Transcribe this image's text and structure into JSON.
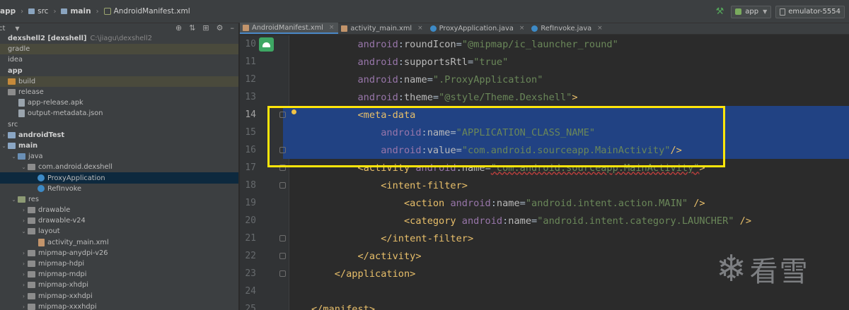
{
  "breadcrumb": [
    "app",
    "src",
    "main",
    "AndroidManifest.xml"
  ],
  "toolbar": {
    "run_config": "app",
    "device": "emulator-5554"
  },
  "project": {
    "header": "ct",
    "rows": [
      {
        "label": "dexshell2 [dexshell]",
        "path": "C:\\jiagu\\dexshell2",
        "bold": true,
        "indent": 0,
        "arrow": "",
        "icon": "none"
      },
      {
        "label": "gradle",
        "indent": 0,
        "arrow": "",
        "icon": "none",
        "excluded": true
      },
      {
        "label": "idea",
        "indent": 0,
        "arrow": "",
        "icon": "none"
      },
      {
        "label": "app",
        "indent": 0,
        "arrow": "",
        "icon": "none",
        "bold": true
      },
      {
        "label": "build",
        "indent": 0,
        "arrow": "",
        "icon": "folder-orange",
        "excluded": true
      },
      {
        "label": "release",
        "indent": 0,
        "arrow": "",
        "icon": "folder"
      },
      {
        "label": "app-release.apk",
        "indent": 1,
        "arrow": "",
        "icon": "file"
      },
      {
        "label": "output-metadata.json",
        "indent": 1,
        "arrow": "",
        "icon": "file"
      },
      {
        "label": "src",
        "indent": 0,
        "arrow": "",
        "icon": "none"
      },
      {
        "label": "androidTest",
        "indent": 0,
        "arrow": "›",
        "icon": "folder-src",
        "bold": true
      },
      {
        "label": "main",
        "indent": 0,
        "arrow": "⌄",
        "icon": "folder-src",
        "bold": true
      },
      {
        "label": "java",
        "indent": 1,
        "arrow": "⌄",
        "icon": "folder-blue"
      },
      {
        "label": "com.android.dexshell",
        "indent": 2,
        "arrow": "⌄",
        "icon": "folder"
      },
      {
        "label": "ProxyApplication",
        "indent": 3,
        "arrow": "",
        "icon": "class-c",
        "selected": true
      },
      {
        "label": "RefInvoke",
        "indent": 3,
        "arrow": "",
        "icon": "class-c"
      },
      {
        "label": "res",
        "indent": 1,
        "arrow": "⌄",
        "icon": "folder-res"
      },
      {
        "label": "drawable",
        "indent": 2,
        "arrow": "›",
        "icon": "folder"
      },
      {
        "label": "drawable-v24",
        "indent": 2,
        "arrow": "›",
        "icon": "folder"
      },
      {
        "label": "layout",
        "indent": 2,
        "arrow": "⌄",
        "icon": "folder"
      },
      {
        "label": "activity_main.xml",
        "indent": 3,
        "arrow": "",
        "icon": "file-xml"
      },
      {
        "label": "mipmap-anydpi-v26",
        "indent": 2,
        "arrow": "›",
        "icon": "folder"
      },
      {
        "label": "mipmap-hdpi",
        "indent": 2,
        "arrow": "›",
        "icon": "folder"
      },
      {
        "label": "mipmap-mdpi",
        "indent": 2,
        "arrow": "›",
        "icon": "folder"
      },
      {
        "label": "mipmap-xhdpi",
        "indent": 2,
        "arrow": "›",
        "icon": "folder"
      },
      {
        "label": "mipmap-xxhdpi",
        "indent": 2,
        "arrow": "›",
        "icon": "folder"
      },
      {
        "label": "mipmap-xxxhdpi",
        "indent": 2,
        "arrow": "›",
        "icon": "folder"
      }
    ]
  },
  "tabs": [
    {
      "label": "AndroidManifest.xml",
      "icon": "xml",
      "active": true
    },
    {
      "label": "activity_main.xml",
      "icon": "xml",
      "active": false
    },
    {
      "label": "ProxyApplication.java",
      "icon": "java",
      "active": false
    },
    {
      "label": "RefInvoke.java",
      "icon": "java",
      "active": false
    }
  ],
  "editor": {
    "lines": [
      {
        "num": "10",
        "indent": "        ",
        "tokens": [
          [
            "ns",
            "android"
          ],
          [
            "punct",
            ":"
          ],
          [
            "attr",
            "roundIcon"
          ],
          [
            "punct",
            "="
          ],
          [
            "str",
            "\"@mipmap/ic_launcher_round\""
          ]
        ]
      },
      {
        "num": "11",
        "indent": "        ",
        "tokens": [
          [
            "ns",
            "android"
          ],
          [
            "punct",
            ":"
          ],
          [
            "attr",
            "supportsRtl"
          ],
          [
            "punct",
            "="
          ],
          [
            "str",
            "\"true\""
          ]
        ]
      },
      {
        "num": "12",
        "indent": "        ",
        "tokens": [
          [
            "ns",
            "android"
          ],
          [
            "punct",
            ":"
          ],
          [
            "attr",
            "name"
          ],
          [
            "punct",
            "="
          ],
          [
            "str",
            "\".ProxyApplication\""
          ]
        ]
      },
      {
        "num": "13",
        "indent": "        ",
        "tokens": [
          [
            "ns",
            "android"
          ],
          [
            "punct",
            ":"
          ],
          [
            "attr",
            "theme"
          ],
          [
            "punct",
            "="
          ],
          [
            "str",
            "\"@style/Theme.Dexshell\""
          ],
          [
            "tag",
            ">"
          ]
        ]
      },
      {
        "num": "14",
        "indent": "        ",
        "selected": true,
        "current": true,
        "bulb": true,
        "fold": true,
        "tokens": [
          [
            "tag",
            "<meta-data"
          ]
        ]
      },
      {
        "num": "15",
        "indent": "            ",
        "selected": true,
        "tokens": [
          [
            "ns",
            "android"
          ],
          [
            "punct",
            ":"
          ],
          [
            "attr",
            "name"
          ],
          [
            "punct",
            "="
          ],
          [
            "str",
            "\"APPLICATION_CLASS_NAME\""
          ]
        ]
      },
      {
        "num": "16",
        "indent": "            ",
        "selected": true,
        "fold": true,
        "tokens": [
          [
            "ns",
            "android"
          ],
          [
            "punct",
            ":"
          ],
          [
            "attr",
            "value"
          ],
          [
            "punct",
            "="
          ],
          [
            "str",
            "\"com.android.sourceapp.MainActivity\""
          ],
          [
            "tag",
            "/>"
          ]
        ]
      },
      {
        "num": "17",
        "indent": "        ",
        "fold": true,
        "tokens": [
          [
            "tag",
            "<activity "
          ],
          [
            "ns",
            "android"
          ],
          [
            "punct",
            ":"
          ],
          [
            "attr",
            "name"
          ],
          [
            "punct",
            "="
          ],
          [
            "str",
            "\"com.android.sourceapp.MainActivity\""
          ],
          [
            "tag",
            ">"
          ]
        ]
      },
      {
        "num": "18",
        "indent": "            ",
        "fold": true,
        "tokens": [
          [
            "tag",
            "<intent-filter>"
          ]
        ]
      },
      {
        "num": "19",
        "indent": "                ",
        "tokens": [
          [
            "tag",
            "<action "
          ],
          [
            "ns",
            "android"
          ],
          [
            "punct",
            ":"
          ],
          [
            "attr",
            "name"
          ],
          [
            "punct",
            "="
          ],
          [
            "str",
            "\"android.intent.action.MAIN\""
          ],
          [
            "tag",
            " />"
          ]
        ]
      },
      {
        "num": "20",
        "indent": "                ",
        "tokens": [
          [
            "tag",
            "<category "
          ],
          [
            "ns",
            "android"
          ],
          [
            "punct",
            ":"
          ],
          [
            "attr",
            "name"
          ],
          [
            "punct",
            "="
          ],
          [
            "str",
            "\"android.intent.category.LAUNCHER\""
          ],
          [
            "tag",
            " />"
          ]
        ]
      },
      {
        "num": "21",
        "indent": "            ",
        "fold": true,
        "tokens": [
          [
            "tag",
            "</intent-filter>"
          ]
        ]
      },
      {
        "num": "22",
        "indent": "        ",
        "fold": true,
        "tokens": [
          [
            "tag",
            "</activity>"
          ]
        ]
      },
      {
        "num": "23",
        "indent": "    ",
        "fold": true,
        "tokens": [
          [
            "tag",
            "</application>"
          ]
        ]
      },
      {
        "num": "24",
        "indent": "",
        "tokens": []
      },
      {
        "num": "25",
        "indent": "",
        "tokens": [
          [
            "tag",
            "</manifest>"
          ]
        ]
      }
    ]
  },
  "watermark": {
    "text": "看雪"
  }
}
